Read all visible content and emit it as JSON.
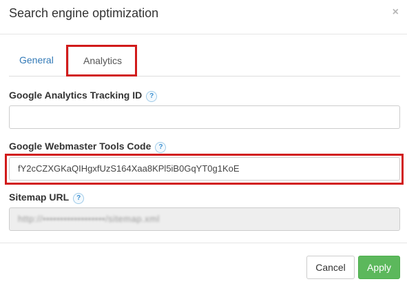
{
  "dialog": {
    "title": "Search engine optimization",
    "close_glyph": "×"
  },
  "tabs": [
    {
      "label": "General",
      "active": false
    },
    {
      "label": "Analytics",
      "active": true
    }
  ],
  "fields": {
    "tracking_id": {
      "label": "Google Analytics Tracking ID",
      "value": ""
    },
    "webmaster_code": {
      "label": "Google Webmaster Tools Code",
      "value": "fY2cCZXGKaQIHgxfUzS164Xaa8KPl5iB0GqYT0g1KoE"
    },
    "sitemap_url": {
      "label": "Sitemap URL",
      "value": "http://••••••••••••••••••/sitemap.xml"
    }
  },
  "help_glyph": "?",
  "footer": {
    "cancel_label": "Cancel",
    "apply_label": "Apply"
  },
  "colors": {
    "link": "#337ab7",
    "highlight": "#d11a1a",
    "apply": "#5cb85c"
  }
}
